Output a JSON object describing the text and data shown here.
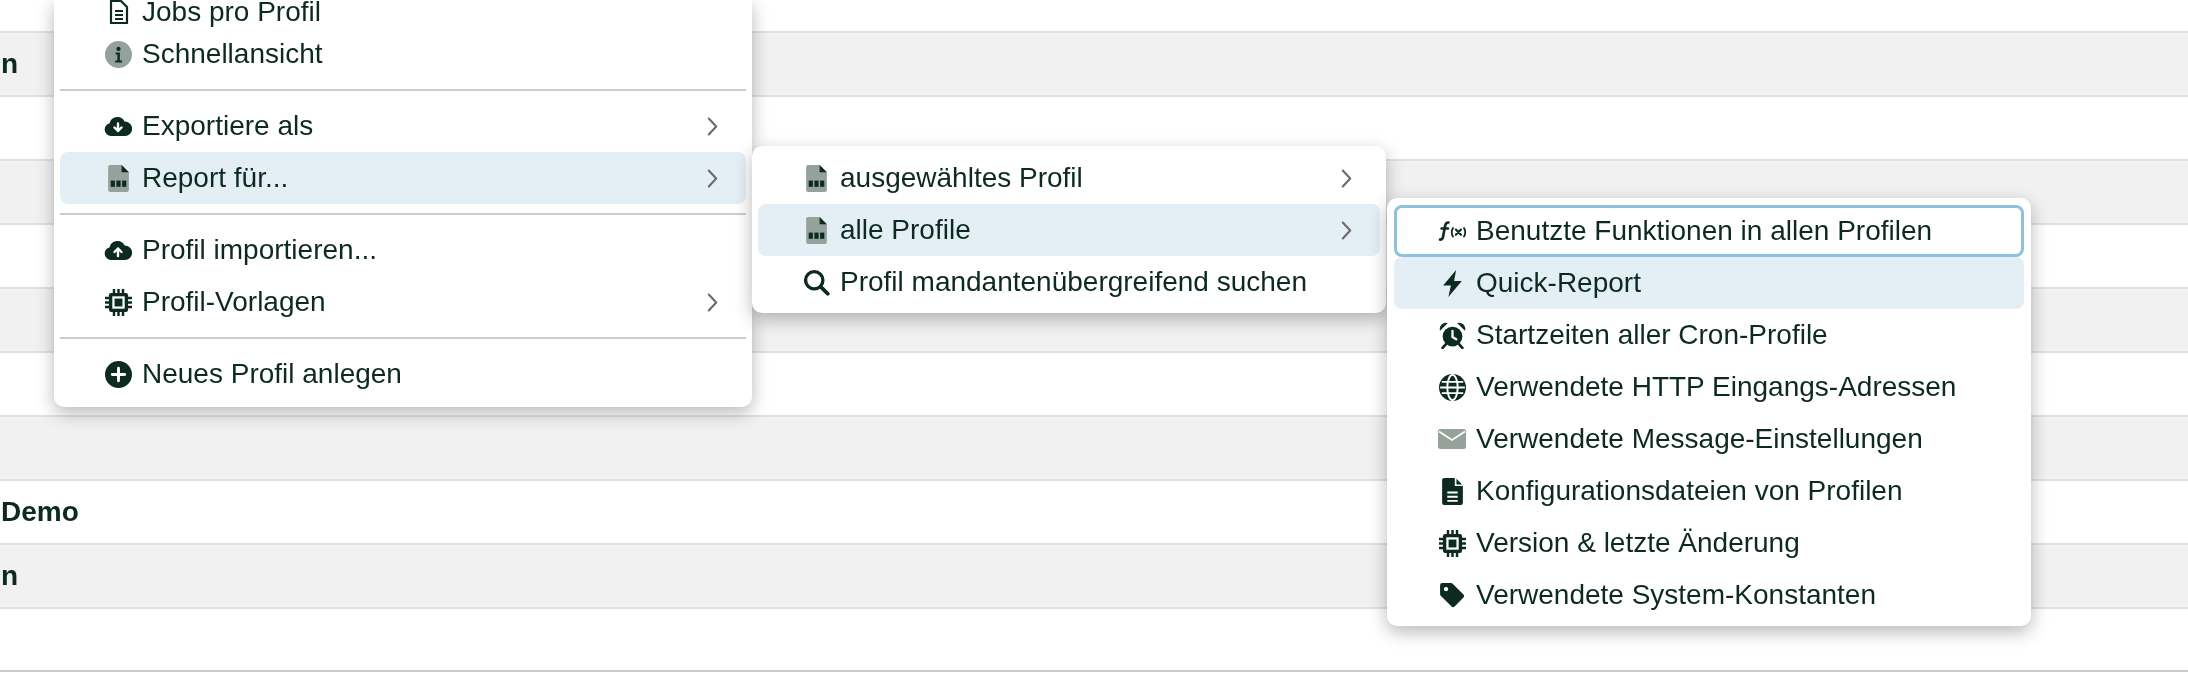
{
  "table": {
    "rows": [
      {},
      {
        "column_1": "n"
      },
      {},
      {},
      {},
      {},
      {},
      {},
      {
        "column_1": "Demo"
      },
      {
        "column_1": "n"
      },
      {}
    ]
  },
  "context_menu": {
    "items": [
      {
        "kind": "item",
        "label": "Jobs pro Profil",
        "has_submenu": false,
        "selected": false
      },
      {
        "kind": "item",
        "label": "Schnellansicht",
        "has_submenu": false,
        "selected": false
      },
      {
        "kind": "separator"
      },
      {
        "kind": "item",
        "label": "Exportiere als",
        "has_submenu": true,
        "selected": false
      },
      {
        "kind": "item",
        "label": "Report für...",
        "has_submenu": true,
        "selected": true
      },
      {
        "kind": "separator"
      },
      {
        "kind": "item",
        "label": "Profil importieren...",
        "has_submenu": false,
        "selected": false
      },
      {
        "kind": "item",
        "label": "Profil-Vorlagen",
        "has_submenu": true,
        "selected": false
      },
      {
        "kind": "separator"
      },
      {
        "kind": "item",
        "label": "Neues Profil anlegen",
        "has_submenu": false,
        "selected": false
      }
    ]
  },
  "submenu": {
    "items": [
      {
        "kind": "item",
        "label": "ausgewähltes Profil",
        "has_submenu": true,
        "selected": false
      },
      {
        "kind": "item",
        "label": "alle Profile",
        "has_submenu": true,
        "selected": true
      },
      {
        "kind": "item",
        "label": "Profil mandantenübergreifend suchen",
        "has_submenu": false,
        "selected": false
      }
    ]
  },
  "submenu_2": {
    "items": [
      {
        "kind": "item",
        "label": "Benutzte Funktionen in allen Profilen",
        "selected": false,
        "focused": true
      },
      {
        "kind": "item",
        "label": "Quick-Report",
        "selected": true,
        "focused": false
      },
      {
        "kind": "item",
        "label": "Startzeiten aller Cron-Profile",
        "selected": false,
        "focused": false
      },
      {
        "kind": "item",
        "label": "Verwendete HTTP Eingangs-Adressen",
        "selected": false,
        "focused": false
      },
      {
        "kind": "item",
        "label": "Verwendete Message-Einstellungen",
        "selected": false,
        "focused": false
      },
      {
        "kind": "item",
        "label": "Konfigurationsdateien von Profilen",
        "selected": false,
        "focused": false
      },
      {
        "kind": "item",
        "label": "Version & letzte Änderung",
        "selected": false,
        "focused": false
      },
      {
        "kind": "item",
        "label": "Verwendete System-Konstanten",
        "selected": false,
        "focused": false
      }
    ]
  }
}
